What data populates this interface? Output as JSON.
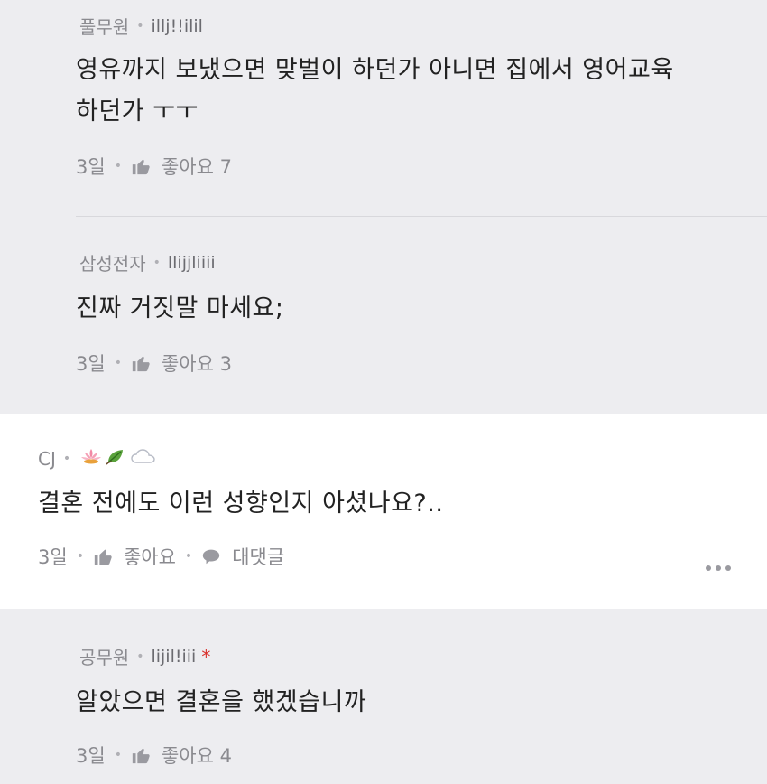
{
  "comments": [
    {
      "nickname": "풀무원",
      "user_id": "illj!!ilil",
      "text_lines": [
        "영유까지 보냈으면 맞벌이 하던가 아니면 집에서 영어교육",
        "하던가 ㅜㅜ"
      ],
      "time": "3일",
      "like_label": "좋아요 7"
    },
    {
      "nickname": "삼성전자",
      "user_id": "llijjliiii",
      "text_lines": [
        "진짜 거짓말 마세요;"
      ],
      "time": "3일",
      "like_label": "좋아요 3"
    },
    {
      "nickname": "CJ",
      "badges": [
        "lotus-icon",
        "leaf-icon",
        "cloud-icon"
      ],
      "text_lines": [
        "결혼 전에도 이런 성향인지 아셨나요?.."
      ],
      "time": "3일",
      "like_label": "좋아요",
      "reply_label": "대댓글"
    },
    {
      "nickname": "공무원",
      "user_id": "lijil!iii",
      "star": "*",
      "text_lines": [
        "알았으면 결혼을 했겠습니까"
      ],
      "time": "3일",
      "like_label": "좋아요 4"
    }
  ],
  "colors": {
    "reply_bg": "#ededf0",
    "main_bg": "#ffffff",
    "star": "#d9302c",
    "meta": "#8a8a8f"
  }
}
